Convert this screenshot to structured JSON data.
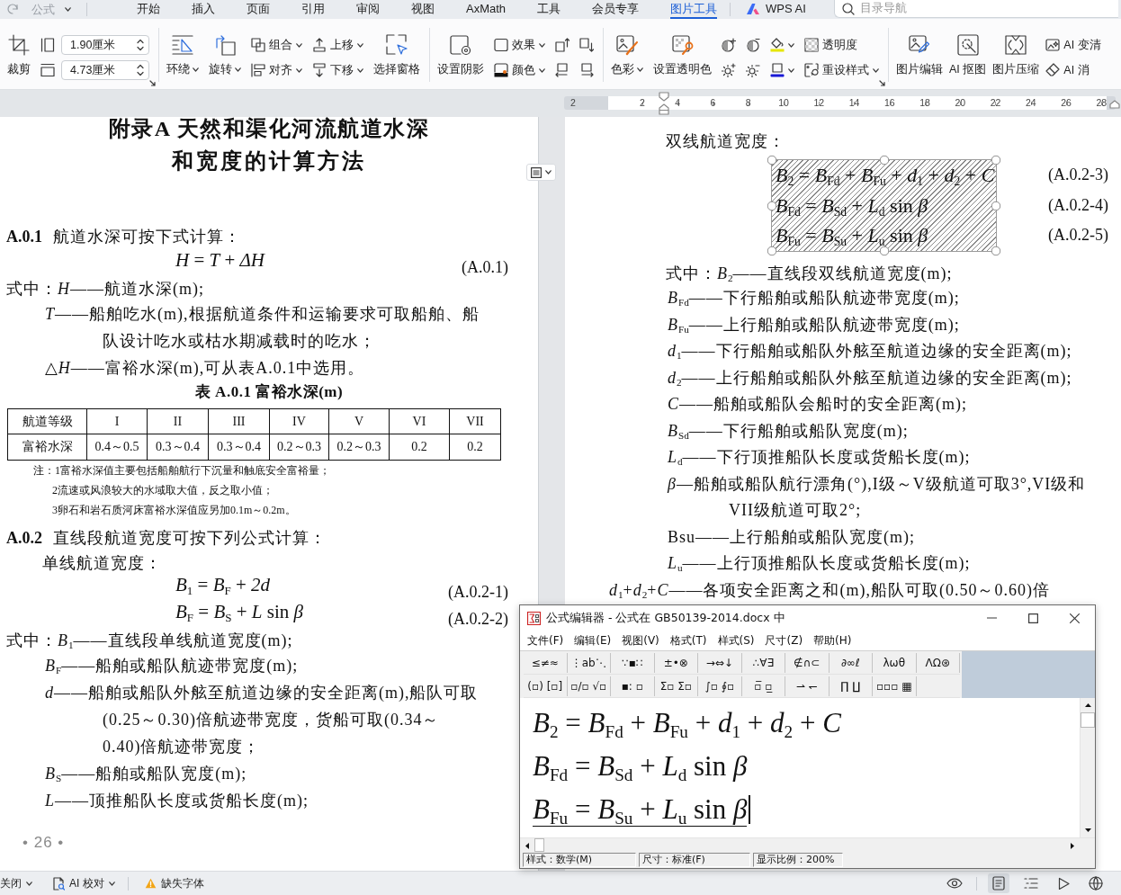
{
  "quick_access": {
    "label": "公式"
  },
  "tabs": [
    {
      "label": "开始",
      "selected": false
    },
    {
      "label": "插入",
      "selected": false
    },
    {
      "label": "页面",
      "selected": false
    },
    {
      "label": "引用",
      "selected": false
    },
    {
      "label": "审阅",
      "selected": false
    },
    {
      "label": "视图",
      "selected": false
    },
    {
      "label": "AxMath",
      "selected": false
    },
    {
      "label": "工具",
      "selected": false
    },
    {
      "label": "会员专享",
      "selected": false
    },
    {
      "label": "图片工具",
      "selected": true
    }
  ],
  "ai_tab": {
    "label": "WPS AI",
    "selected": false
  },
  "search": {
    "placeholder": "目录导航"
  },
  "ribbon": {
    "groups": [
      {
        "launcher": true,
        "columns": [
          {
            "kind": "large",
            "label": "裁剪",
            "dropdown": false
          },
          {
            "kind": "stack",
            "items": [
              {
                "kind": "size",
                "value": "1.90厘米"
              },
              {
                "kind": "size",
                "value": "4.73厘米"
              }
            ]
          }
        ]
      },
      {
        "launcher": false,
        "columns": [
          {
            "kind": "large",
            "label": "环绕",
            "dropdown": true
          },
          {
            "kind": "large",
            "label": "旋转",
            "dropdown": true
          },
          {
            "kind": "stack",
            "items": [
              {
                "kind": "small",
                "label": "组合",
                "dropdown": true
              },
              {
                "kind": "small",
                "label": "对齐",
                "dropdown": true
              }
            ]
          },
          {
            "kind": "stack",
            "items": [
              {
                "kind": "small",
                "label": "上移",
                "dropdown": true
              },
              {
                "kind": "small",
                "label": "下移",
                "dropdown": true
              }
            ]
          },
          {
            "kind": "large",
            "label": "选择窗格",
            "dropdown": false
          }
        ]
      },
      {
        "launcher": false,
        "columns": [
          {
            "kind": "large",
            "label": "设置阴影",
            "dropdown": false
          },
          {
            "kind": "stack",
            "items": [
              {
                "kind": "small",
                "label": "效果",
                "dropdown": true
              },
              {
                "kind": "small",
                "label": "颜色",
                "dropdown": true
              }
            ]
          },
          {
            "kind": "stack",
            "items": [
              {
                "kind": "icon",
                "dropdown": false
              },
              {
                "kind": "icon",
                "dropdown": false
              }
            ]
          },
          {
            "kind": "stack",
            "items": [
              {
                "kind": "icon",
                "dropdown": false
              },
              {
                "kind": "icon",
                "dropdown": false
              }
            ]
          }
        ]
      },
      {
        "launcher": true,
        "columns": [
          {
            "kind": "large",
            "label": "色彩",
            "dropdown": true
          },
          {
            "kind": "large",
            "label": "设置透明色",
            "dropdown": false
          },
          {
            "kind": "stack",
            "items": [
              {
                "kind": "icon",
                "dropdown": false
              },
              {
                "kind": "icon",
                "dropdown": false
              }
            ]
          },
          {
            "kind": "stack",
            "items": [
              {
                "kind": "icon",
                "dropdown": false
              },
              {
                "kind": "icon",
                "dropdown": false
              }
            ]
          },
          {
            "kind": "stack",
            "items": [
              {
                "kind": "icon",
                "dropdown": true
              },
              {
                "kind": "icon",
                "dropdown": true
              }
            ]
          },
          {
            "kind": "stack",
            "items": [
              {
                "kind": "small",
                "label": "透明度",
                "dropdown": false
              },
              {
                "kind": "small",
                "label": "重设样式",
                "dropdown": true
              }
            ]
          }
        ]
      },
      {
        "launcher": false,
        "columns": [
          {
            "kind": "large",
            "label": "图片编辑",
            "dropdown": false
          },
          {
            "kind": "large",
            "label": "AI 抠图",
            "dropdown": false
          },
          {
            "kind": "large",
            "label": "图片压缩",
            "dropdown": false
          },
          {
            "kind": "stack",
            "items": [
              {
                "kind": "small",
                "label": "AI 变清",
                "dropdown": false
              },
              {
                "kind": "small",
                "label": "AI 消",
                "dropdown": false
              }
            ]
          }
        ]
      }
    ]
  },
  "ruler": {
    "labels": [
      "2",
      "2",
      "4",
      "6",
      "8",
      "10",
      "12",
      "14",
      "16",
      "18",
      "20",
      "22",
      "24",
      "26",
      "28"
    ]
  },
  "left_page": {
    "title_lines": [
      "附录A 天然和渠化河流航道水深",
      "和宽度的计算方法"
    ],
    "blocks": [
      {
        "kind": "clause",
        "text": "**A.0.1** 航道水深可按下式计算："
      },
      {
        "kind": "formula",
        "text": "*H* = *T* + *ΔH*",
        "number": "(A.0.1)"
      },
      {
        "kind": "where",
        "text": "式中：*H*——航道水深(m);"
      },
      {
        "kind": "definition",
        "text": "*T*——船舶吃水(m),根据航道条件和运输要求可取船舶、船"
      },
      {
        "kind": "continuation",
        "text": "队设计吃水或枯水期减载时的吃水；"
      },
      {
        "kind": "definition",
        "text": "△*H*——富裕水深(m),可从表A.0.1中选用。"
      },
      {
        "kind": "caption",
        "text": "表 A.0.1 富裕水深(m)"
      },
      {
        "kind": "table",
        "header": [
          "航道等级",
          "I",
          "II",
          "III",
          "IV",
          "V",
          "VI",
          "VII"
        ],
        "rows": [
          [
            "富裕水深",
            "0.4～0.5",
            "0.3～0.4",
            "0.3～0.4",
            "0.2～0.3",
            "0.2～0.3",
            "0.2",
            "0.2"
          ]
        ]
      },
      {
        "kind": "note",
        "text": "注：1富裕水深值主要包括船舶航行下沉量和触底安全富裕量；"
      },
      {
        "kind": "note_item",
        "text": "2流速或风浪较大的水域取大值，反之取小值；"
      },
      {
        "kind": "note_item",
        "text": "3卵石和岩石质河床富裕水深值应另加0.1m～0.2m。"
      },
      {
        "kind": "clause",
        "text": "**A.0.2** 直线段航道宽度可按下列公式计算："
      },
      {
        "kind": "subhead",
        "text": "单线航道宽度："
      },
      {
        "kind": "formula",
        "text": "*B*$_{1}$ = *B*$_{F}$ + *2d*",
        "number": "(A.0.2-1)"
      },
      {
        "kind": "formula",
        "text": "*B*$_{F}$ = *B*$_{S}$ + *L* sin *β*",
        "number": "(A.0.2-2)"
      },
      {
        "kind": "where",
        "text": "式中：*B*$_{1}$——直线段单线航道宽度(m);"
      },
      {
        "kind": "definition",
        "text": "*B*$_{F}$——船舶或船队航迹带宽度(m);"
      },
      {
        "kind": "definition",
        "text": "*d*——船舶或船队外舷至航道边缘的安全距离(m),船队可取"
      },
      {
        "kind": "continuation",
        "text": "(0.25～0.30)倍航迹带宽度，货船可取(0.34～"
      },
      {
        "kind": "continuation",
        "text": "0.40)倍航迹带宽度；"
      },
      {
        "kind": "definition",
        "text": "*B*$_{S}$——船舶或船队宽度(m);"
      },
      {
        "kind": "definition",
        "text": "*L*——顶推船队长度或货船长度(m);"
      }
    ],
    "page_number": "• 26 •"
  },
  "right_page": {
    "blocks": [
      {
        "kind": "subhead",
        "text": "双线航道宽度："
      },
      {
        "kind": "formula_group",
        "selected": true,
        "lines": [
          {
            "text": "*B*$_{2}$ = *B*$_{Fd}$ + *B*$_{Fu}$ + *d*$_{1}$ + *d*$_{2}$ + *C*",
            "number": "(A.0.2-3)"
          },
          {
            "text": "*B*$_{Fd}$ = *B*$_{Sd}$ + *L*$_{d}$ sin *β*",
            "number": "(A.0.2-4)"
          },
          {
            "text": "*B*$_{Fu}$ = *B*$_{Su}$ + *L*$_{u}$ sin *β*",
            "number": "(A.0.2-5)"
          }
        ]
      },
      {
        "kind": "where",
        "text": "式中：*B*$_{2}$——直线段双线航道宽度(m);"
      },
      {
        "kind": "definition",
        "text": "*B*$_{Fd}$——下行船舶或船队航迹带宽度(m);"
      },
      {
        "kind": "definition",
        "text": "*B*$_{Fu}$——上行船舶或船队航迹带宽度(m);"
      },
      {
        "kind": "definition",
        "text": "*d*$_{1}$——下行船舶或船队外舷至航道边缘的安全距离(m);"
      },
      {
        "kind": "definition",
        "text": "*d*$_{2}$——上行船舶或船队外舷至航道边缘的安全距离(m);"
      },
      {
        "kind": "definition",
        "text": "*C*——船舶或船队会船时的安全距离(m);"
      },
      {
        "kind": "definition",
        "text": "*B*$_{Sd}$——下行船舶或船队宽度(m);"
      },
      {
        "kind": "definition",
        "text": "*L*$_{d}$——下行顶推船队长度或货船长度(m);"
      },
      {
        "kind": "definition",
        "text": "*β*—船舶或船队航行漂角(°),I级～V级航道可取3°,VI级和"
      },
      {
        "kind": "continuation",
        "text": "VII级航道可取2°;"
      },
      {
        "kind": "definition",
        "text": "Bsu——上行船舶或船队宽度(m);"
      },
      {
        "kind": "definition",
        "text": "*L*$_{u}$——上行顶推船队长度或货船长度(m);"
      },
      {
        "kind": "hanging",
        "text": "*d*$_{1}$+*d*$_{2}$+*C*——各项安全距离之和(m),船队可取(0.50～0.60)倍"
      }
    ]
  },
  "equation_editor": {
    "title": "公式编辑器 - 公式在 GB50139-2014.docx 中",
    "menu": [
      "文件(F)",
      "编辑(E)",
      "视图(V)",
      "格式(T)",
      "样式(S)",
      "尺寸(Z)",
      "帮助(H)"
    ],
    "palette_rows": [
      [
        "≤≠≈",
        "⋮ab⋱",
        "∵▪∷",
        "±•⊗",
        "→⇔↓",
        "∴∀∃",
        "∉∩⊂",
        "∂∞ℓ",
        "λωθ",
        "ΛΩ⊛"
      ],
      [
        "(▫) [▫]",
        "▫/▫ √▫",
        "▪: ▫",
        "Σ▫ Σ▫",
        "∫▫ ∮▫",
        "▫̅ ▫̲",
        "⇀ ↽",
        "∏ ∐",
        "▫▫▫ ▦"
      ]
    ],
    "equations": [
      {
        "text": "*B*$_{2}$ = *B*$_{Fd}$ + *B*$_{Fu}$ + *d*$_{1}$ + *d*$_{2}$ + *C*",
        "active": false
      },
      {
        "text": "*B*$_{Fd}$ = *B*$_{Sd}$ + *L*$_{d}$ sin *β*",
        "active": false
      },
      {
        "text": "*B*$_{Fu}$ = *B*$_{Su}$ + *L*$_{u}$ sin *β*",
        "active": true
      }
    ],
    "status": [
      "样式：数学(M)",
      "尺寸：标准(F)",
      "显示比例：200%"
    ]
  },
  "status_bar": {
    "items": [
      {
        "label": "关闭",
        "dropdown": true
      },
      {
        "label": "AI 校对",
        "dropdown": true
      },
      {
        "label": "缺失字体",
        "dropdown": false
      }
    ],
    "views": [
      {
        "selected": false
      },
      {
        "selected": true
      },
      {
        "selected": false
      },
      {
        "selected": false
      },
      {
        "selected": false
      }
    ]
  }
}
